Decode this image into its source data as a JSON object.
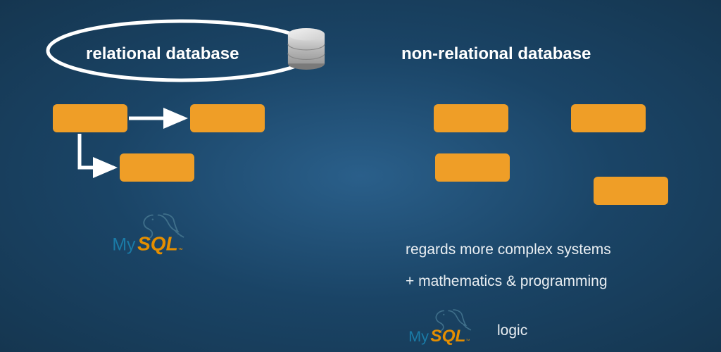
{
  "left": {
    "heading": "relational database",
    "logo": {
      "my": "My",
      "sql": "SQL",
      "tm": "™"
    }
  },
  "right": {
    "heading": "non-relational database",
    "line1": "regards more complex systems",
    "line2": "+ mathematics & programming",
    "line3": "logic",
    "logo": {
      "my": "My",
      "sql": "SQL",
      "tm": "™"
    }
  },
  "colors": {
    "box": "#ef9e27",
    "mysql_my": "#1a7aa6",
    "mysql_sql": "#e48e00"
  }
}
